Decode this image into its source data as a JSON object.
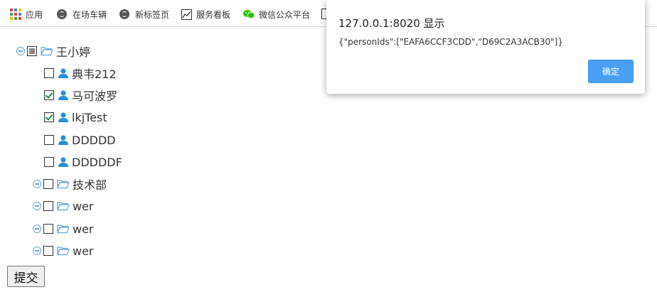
{
  "bookmarks": [
    {
      "label": "应用",
      "icon": "apps-grid-icon"
    },
    {
      "label": "在场车辆",
      "icon": "globe-icon"
    },
    {
      "label": "新标签页",
      "icon": "globe-icon"
    },
    {
      "label": "服务看板",
      "icon": "chart-icon"
    },
    {
      "label": "微信公众平台",
      "icon": "wechat-icon"
    }
  ],
  "tree": {
    "root": {
      "label": "王小婷",
      "state": "partial"
    },
    "people": [
      {
        "label": "典韦212",
        "checked": false
      },
      {
        "label": "马可波罗",
        "checked": true
      },
      {
        "label": "lkjTest",
        "checked": true
      },
      {
        "label": "DDDDD",
        "checked": false
      },
      {
        "label": "DDDDDF",
        "checked": false
      }
    ],
    "groups": [
      {
        "label": "技术部"
      },
      {
        "label": "wer"
      },
      {
        "label": "wer"
      },
      {
        "label": "wer"
      }
    ]
  },
  "submit_label": "提交",
  "dialog": {
    "title": "127.0.0.1:8020 显示",
    "message": "{\"personIds\":[\"EAFA6CCF3CDD\",\"D69C2A3ACB30\"]}",
    "ok_label": "确定"
  },
  "colors": {
    "accent": "#4a9ff5",
    "tree_icon": "#6aa7d8",
    "person_icon": "#2a8fd6",
    "check": "#1a8f3a"
  }
}
